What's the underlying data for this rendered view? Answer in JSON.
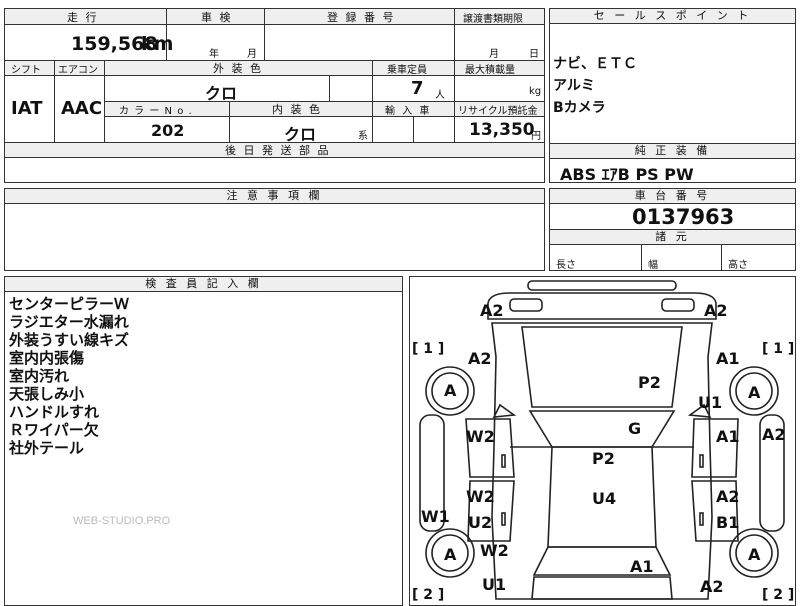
{
  "top": {
    "mileage_label": "走 行",
    "mileage_value": "159,568",
    "mileage_unit": "km",
    "inspection_label": "車 検",
    "inspection_year": "年",
    "inspection_month": "月",
    "registration_label": "登 録 番 号",
    "transfer_label": "譲渡書類期限",
    "transfer_month": "月",
    "transfer_day": "日",
    "shift_label": "シフト",
    "shift_value": "IAT",
    "aircon_label": "エアコン",
    "aircon_value": "AAC",
    "exterior_label": "外 装 色",
    "exterior_value": "クロ",
    "capacity_label": "乗車定員",
    "capacity_value": "7",
    "capacity_unit": "人",
    "maxload_label": "最大積載量",
    "maxload_unit": "kg",
    "colorno_label": "カ ラ ー N o .",
    "colorno_value": "202",
    "interior_label": "内 装 色",
    "interior_value": "クロ",
    "interior_suffix": "系",
    "import_label": "輸 入 車",
    "recycle_label": "リサイクル預託金",
    "recycle_value": "13,350",
    "recycle_unit": "円",
    "later_label": "後 日 発 送 部 品"
  },
  "sales_point": {
    "label": "セ ー ル ス ポ イ ン ト",
    "lines": [
      "ナビ、ＥＴＣ",
      "アルミ",
      "Bカメラ"
    ]
  },
  "standard_equipment": {
    "label": "純 正 装 備",
    "value": "ABS ｴｱB PS PW"
  },
  "notice": {
    "label": "注 意 事 項 欄"
  },
  "chassis": {
    "label": "車 台 番 号",
    "value": "0137963"
  },
  "dimensions": {
    "label": "諸 元",
    "length": "長さ",
    "width": "幅",
    "height": "高さ"
  },
  "inspector": {
    "label": "検 査 員 記 入 欄",
    "lines": [
      "センターピラーＷ",
      "ラジエター水漏れ",
      "外装うすい線キズ",
      "室内内張傷",
      "室内汚れ",
      "天張しみ小",
      "ハンドルすれ",
      "Ｒワイパー欠",
      "社外テール"
    ],
    "watermark": "WEB-STUDIO.PRO"
  },
  "diagram": {
    "labels": {
      "a2_tl": "A2",
      "a2_tr": "A2",
      "b1_l": "[ 1 ]",
      "b1_r": "[ 1 ]",
      "a2_lf": "A2",
      "a1_rf": "A1",
      "p2_hood": "P2",
      "u1_rf": "U1",
      "a_lf": "A",
      "a_rf": "A",
      "g": "G",
      "a2_side": "A2",
      "w2_ld": "W2",
      "a1_rd": "A1",
      "p2_roof": "P2",
      "w2_lr": "W2",
      "a2_rr": "A2",
      "u4": "U4",
      "w1": "W1",
      "u2": "U2",
      "b1_rr": "B1",
      "a_lr": "A",
      "a_rrw": "A",
      "w2_tail": "W2",
      "a1_trunk": "A1",
      "u1_bl": "U1",
      "a2_br": "A2",
      "b2_l": "[ 2 ]",
      "b2_r": "[ 2 ]"
    }
  }
}
